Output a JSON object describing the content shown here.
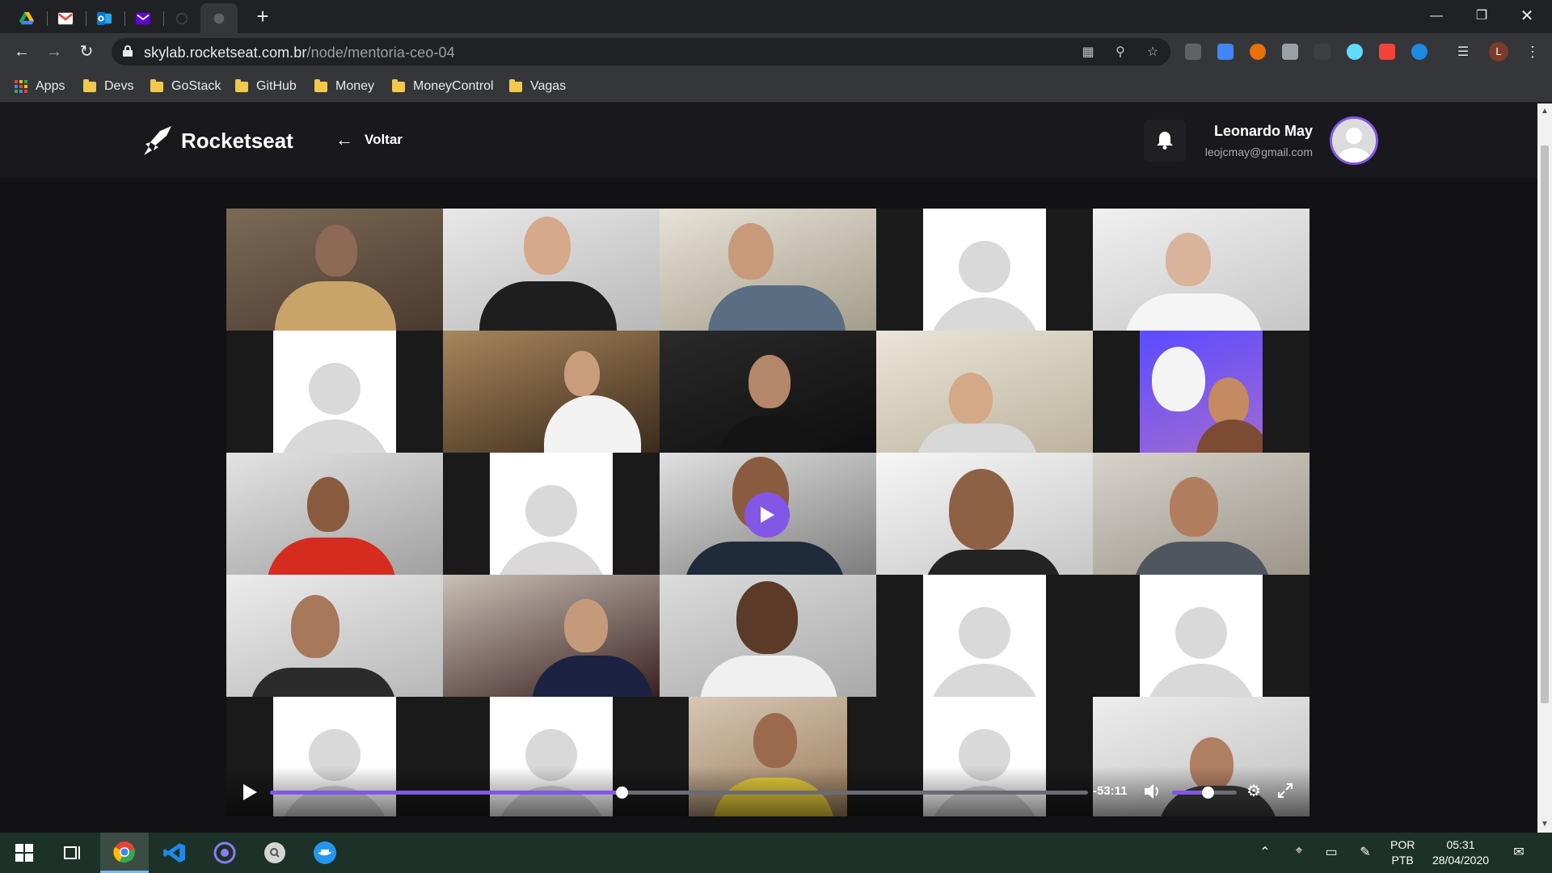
{
  "browser": {
    "tabs": [
      {
        "name": "Google Drive",
        "icon": "google-drive-icon",
        "color": "#1fa463"
      },
      {
        "name": "Gmail",
        "icon": "gmail-icon",
        "color": "#ea4335"
      },
      {
        "name": "Outlook",
        "icon": "outlook-icon",
        "color": "#0078d4"
      },
      {
        "name": "Yahoo Mail",
        "icon": "yahoo-mail-icon",
        "color": "#6001d2"
      },
      {
        "name": "Loading",
        "icon": "loading-icon",
        "color": "#5f6368"
      },
      {
        "name": "Active tab",
        "icon": "tab-icon",
        "color": "#5f6368"
      }
    ],
    "url_host": "skylab.rocketseat.com.br",
    "url_path": "/node/mentoria-ceo-04",
    "profile_initial": "L"
  },
  "bookmarks": [
    {
      "label": "Apps",
      "icon": "apps-grid-icon"
    },
    {
      "label": "Devs",
      "icon": "folder-icon"
    },
    {
      "label": "GoStack",
      "icon": "folder-icon"
    },
    {
      "label": "GitHub",
      "icon": "folder-icon"
    },
    {
      "label": "Money",
      "icon": "folder-icon"
    },
    {
      "label": "MoneyControl",
      "icon": "folder-icon"
    },
    {
      "label": "Vagas",
      "icon": "folder-icon"
    }
  ],
  "header": {
    "brand": "Rocketseat",
    "back_label": "Voltar",
    "user_name": "Leonardo May",
    "user_email": "leojcmay@gmail.com"
  },
  "player": {
    "remaining_time": "-53:11",
    "progress_fraction": 0.43,
    "volume_fraction": 0.55
  },
  "video_grid": {
    "rows": 5,
    "cols": 5,
    "tiles": [
      {
        "type": "camera"
      },
      {
        "type": "camera"
      },
      {
        "type": "camera"
      },
      {
        "type": "placeholder"
      },
      {
        "type": "camera"
      },
      {
        "type": "placeholder"
      },
      {
        "type": "camera"
      },
      {
        "type": "camera"
      },
      {
        "type": "camera"
      },
      {
        "type": "camera"
      },
      {
        "type": "camera"
      },
      {
        "type": "placeholder"
      },
      {
        "type": "camera"
      },
      {
        "type": "camera"
      },
      {
        "type": "camera"
      },
      {
        "type": "camera"
      },
      {
        "type": "camera"
      },
      {
        "type": "camera"
      },
      {
        "type": "placeholder"
      },
      {
        "type": "placeholder"
      },
      {
        "type": "placeholder"
      },
      {
        "type": "placeholder"
      },
      {
        "type": "camera"
      },
      {
        "type": "placeholder"
      },
      {
        "type": "camera"
      }
    ]
  },
  "taskbar": {
    "lang_line1": "POR",
    "lang_line2": "PTB",
    "time": "05:31",
    "date": "28/04/2020"
  },
  "colors": {
    "accent": "#8257e5",
    "page_bg": "#121214",
    "header_bg": "#19191d"
  }
}
